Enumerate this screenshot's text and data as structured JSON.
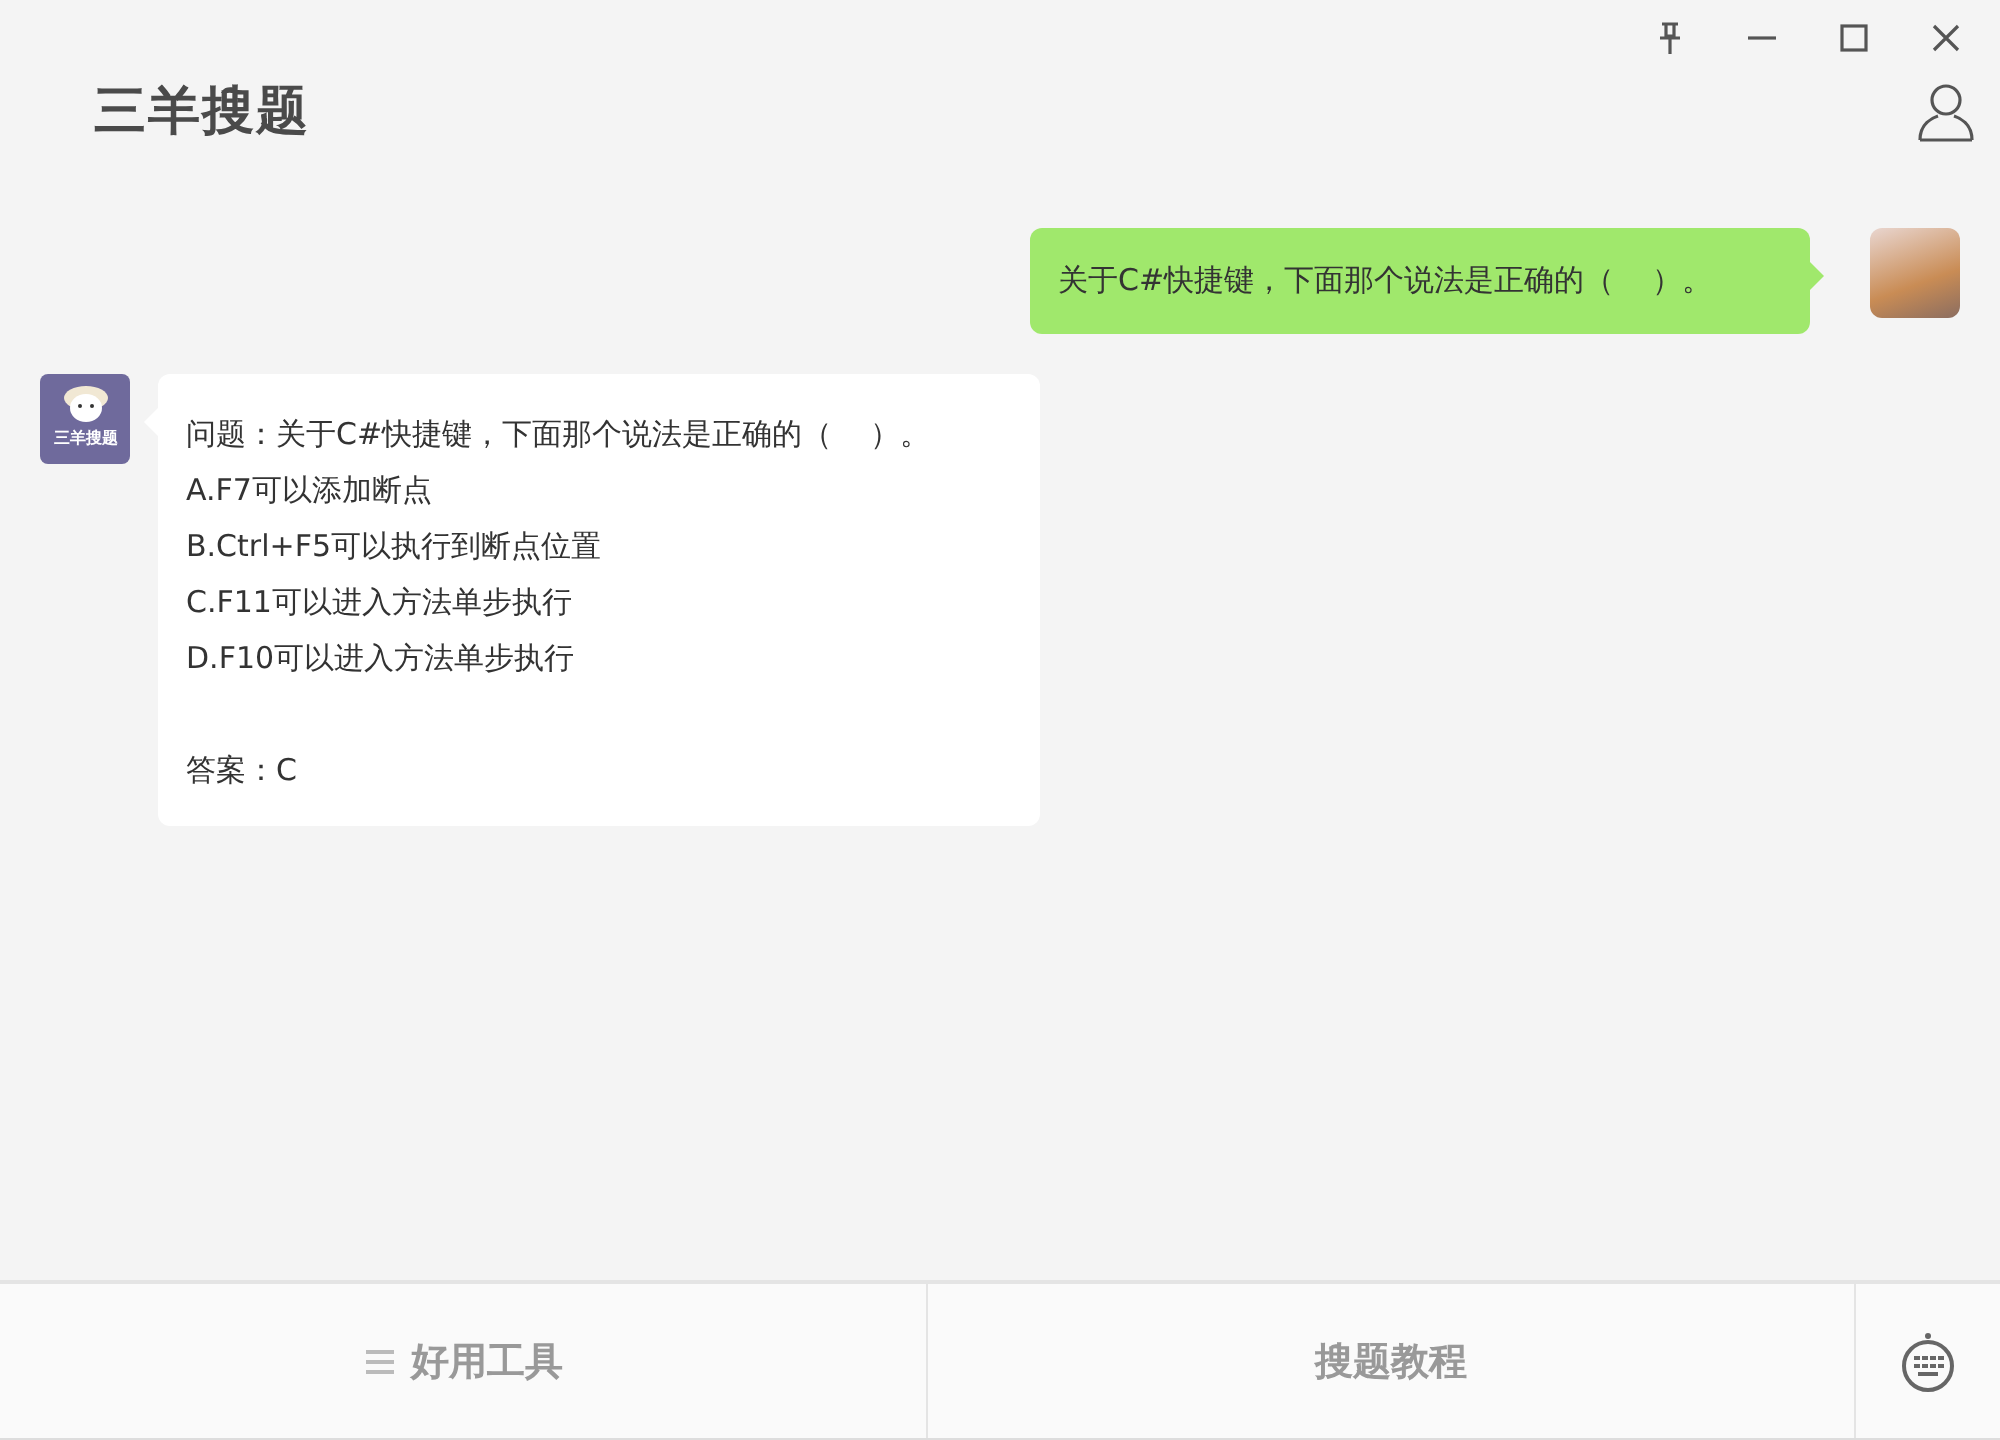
{
  "window": {
    "title": "三羊搜题"
  },
  "messages": [
    {
      "kind": "user",
      "text": "关于C#快捷键，下面那个说法是正确的（    ）。"
    },
    {
      "kind": "bot",
      "avatar_label": "三羊搜题",
      "question": "问题：关于C#快捷键，下面那个说法是正确的（    ）。",
      "options": [
        "A.F7可以添加断点",
        "B.Ctrl+F5可以执行到断点位置",
        "C.F11可以进入方法单步执行",
        "D.F10可以进入方法单步执行"
      ],
      "answer": "答案：C"
    }
  ],
  "bottom_bar": {
    "tabs": [
      {
        "label": "好用工具",
        "menu_icon": true
      },
      {
        "label": "搜题教程",
        "menu_icon": false
      }
    ]
  }
}
